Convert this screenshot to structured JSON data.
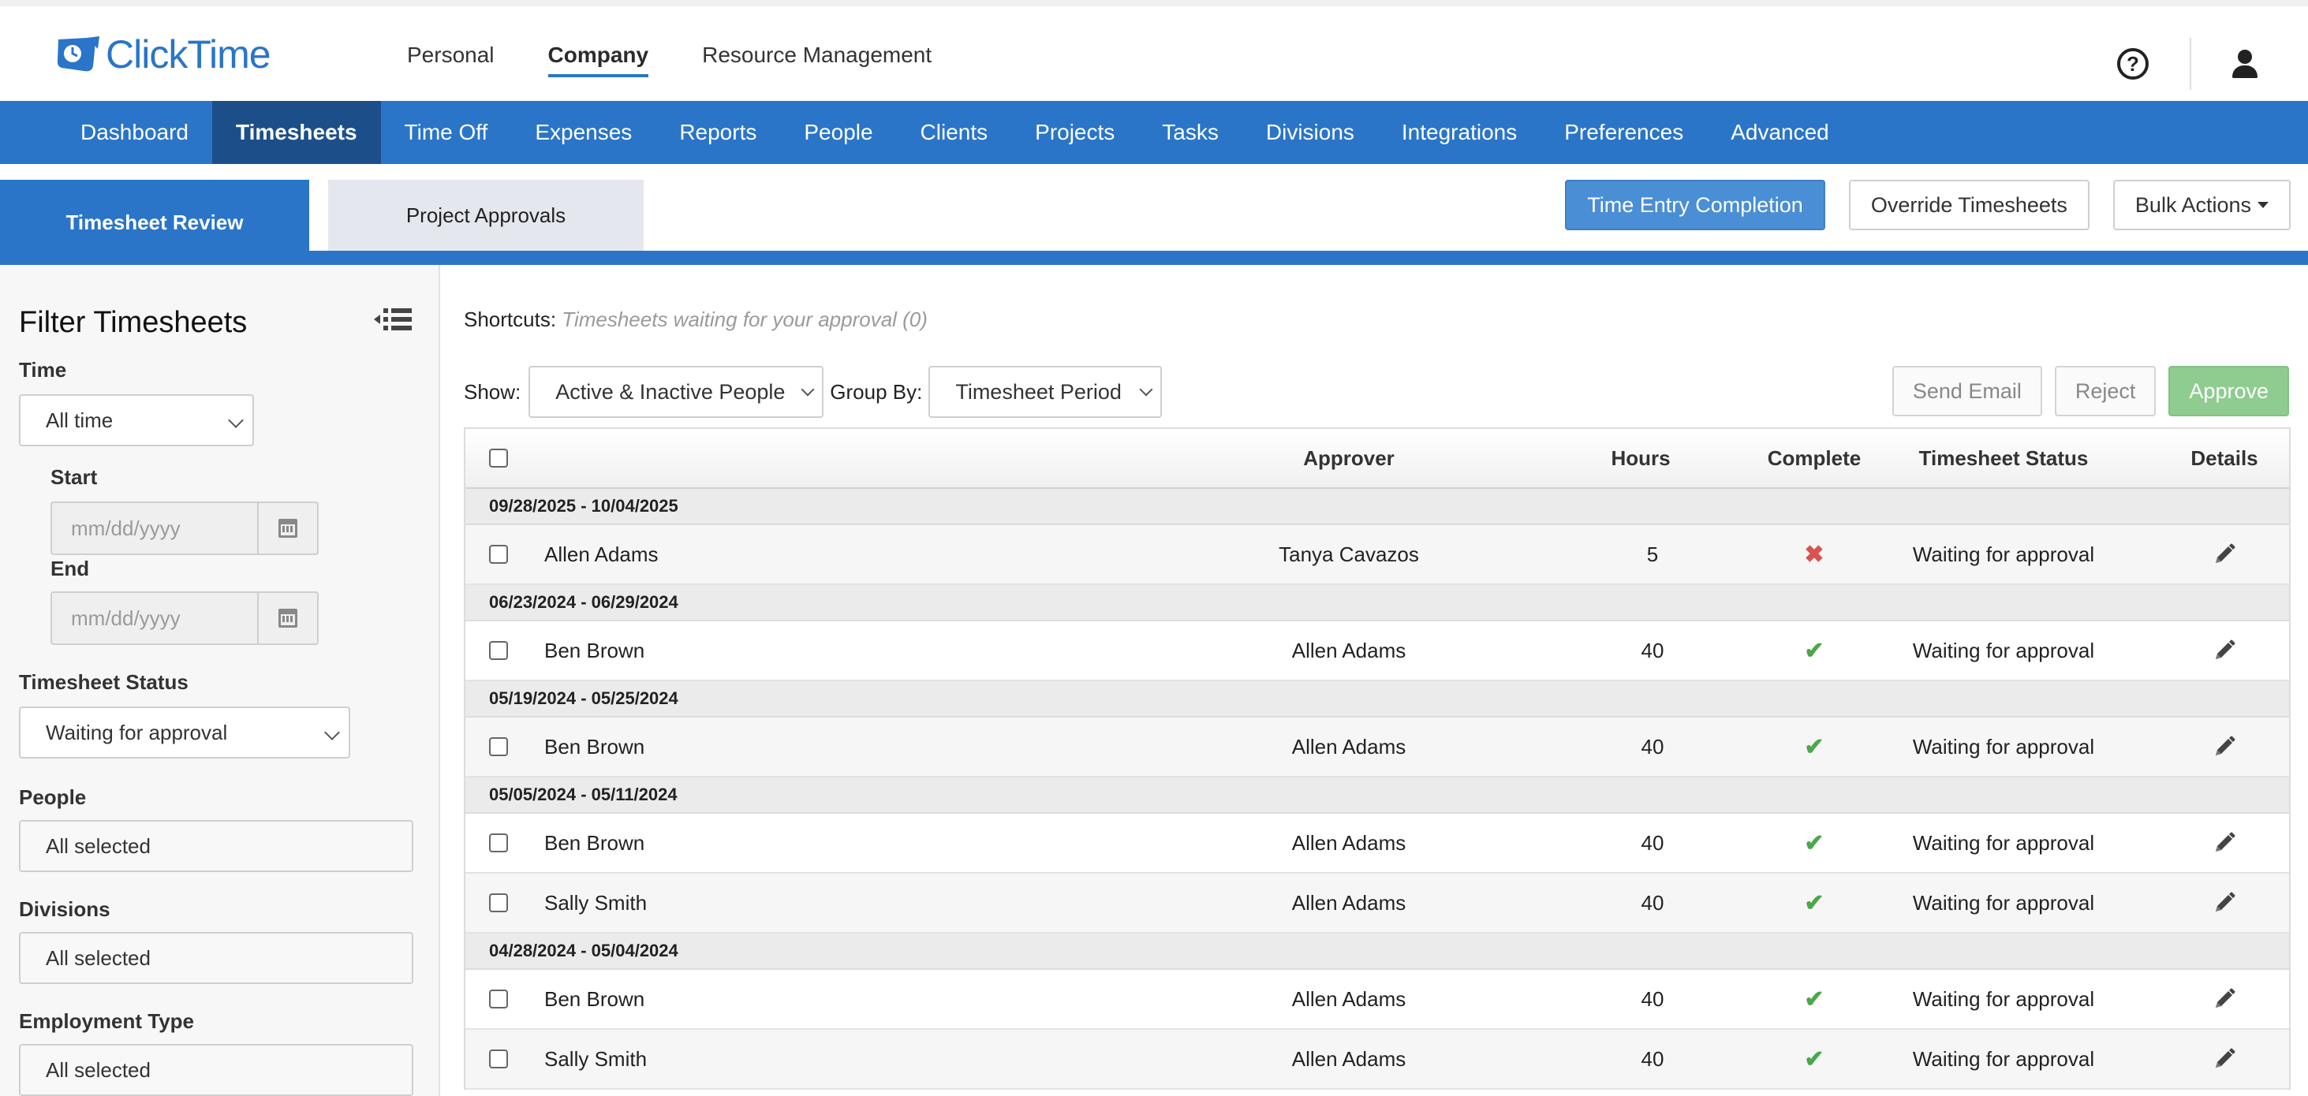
{
  "app": {
    "logo_text": "ClickTime",
    "brand_color": "#2a75c8"
  },
  "topnav": {
    "items": [
      {
        "label": "Personal",
        "active": false
      },
      {
        "label": "Company",
        "active": true
      },
      {
        "label": "Resource Management",
        "active": false
      }
    ],
    "help_icon": "question-circle-icon",
    "user_icon": "user-icon"
  },
  "mainnav": {
    "items": [
      {
        "label": "Dashboard",
        "active": false
      },
      {
        "label": "Timesheets",
        "active": true
      },
      {
        "label": "Time Off",
        "active": false
      },
      {
        "label": "Expenses",
        "active": false
      },
      {
        "label": "Reports",
        "active": false
      },
      {
        "label": "People",
        "active": false
      },
      {
        "label": "Clients",
        "active": false
      },
      {
        "label": "Projects",
        "active": false
      },
      {
        "label": "Tasks",
        "active": false
      },
      {
        "label": "Divisions",
        "active": false
      },
      {
        "label": "Integrations",
        "active": false
      },
      {
        "label": "Preferences",
        "active": false
      },
      {
        "label": "Advanced",
        "active": false
      }
    ]
  },
  "subtabs": {
    "review": "Timesheet Review",
    "approvals": "Project Approvals"
  },
  "sub_actions": {
    "time_entry": "Time Entry Completion",
    "override": "Override Timesheets",
    "bulk": "Bulk Actions"
  },
  "filters": {
    "title": "Filter Timesheets",
    "time_label": "Time",
    "time_value": "All time",
    "start_label": "Start",
    "start_placeholder": "mm/dd/yyyy",
    "end_label": "End",
    "end_placeholder": "mm/dd/yyyy",
    "status_label": "Timesheet Status",
    "status_value": "Waiting for approval",
    "people_label": "People",
    "people_value": "All selected",
    "divisions_label": "Divisions",
    "divisions_value": "All selected",
    "employment_label": "Employment Type",
    "employment_value": "All selected"
  },
  "shortcuts": {
    "label": "Shortcuts:",
    "link": "Timesheets waiting for your approval (0)"
  },
  "controls": {
    "show_label": "Show:",
    "show_value": "Active & Inactive People",
    "group_label": "Group By:",
    "group_value": "Timesheet Period",
    "send_email": "Send Email",
    "reject": "Reject",
    "approve": "Approve"
  },
  "table": {
    "headers": {
      "approver": "Approver",
      "hours": "Hours",
      "complete": "Complete",
      "status": "Timesheet Status",
      "details": "Details"
    },
    "groups": [
      {
        "period": "09/28/2025 - 10/04/2025",
        "rows": [
          {
            "name": "Allen Adams",
            "approver": "Tanya Cavazos",
            "hours": "5",
            "complete": false,
            "status": "Waiting for approval"
          }
        ]
      },
      {
        "period": "06/23/2024 - 06/29/2024",
        "rows": [
          {
            "name": "Ben Brown",
            "approver": "Allen Adams",
            "hours": "40",
            "complete": true,
            "status": "Waiting for approval"
          }
        ]
      },
      {
        "period": "05/19/2024 - 05/25/2024",
        "rows": [
          {
            "name": "Ben Brown",
            "approver": "Allen Adams",
            "hours": "40",
            "complete": true,
            "status": "Waiting for approval"
          }
        ]
      },
      {
        "period": "05/05/2024 - 05/11/2024",
        "rows": [
          {
            "name": "Ben Brown",
            "approver": "Allen Adams",
            "hours": "40",
            "complete": true,
            "status": "Waiting for approval"
          },
          {
            "name": "Sally Smith",
            "approver": "Allen Adams",
            "hours": "40",
            "complete": true,
            "status": "Waiting for approval"
          }
        ]
      },
      {
        "period": "04/28/2024 - 05/04/2024",
        "rows": [
          {
            "name": "Ben Brown",
            "approver": "Allen Adams",
            "hours": "40",
            "complete": true,
            "status": "Waiting for approval"
          },
          {
            "name": "Sally Smith",
            "approver": "Allen Adams",
            "hours": "40",
            "complete": true,
            "status": "Waiting for approval"
          }
        ]
      }
    ]
  }
}
